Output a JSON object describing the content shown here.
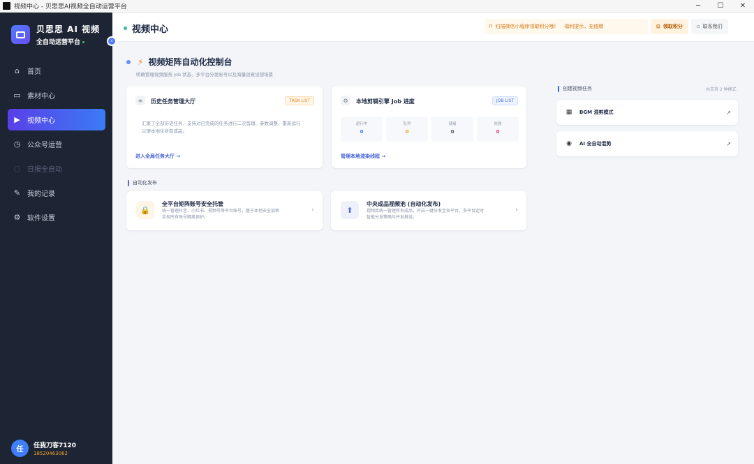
{
  "window": {
    "title": "视频中心 - 贝思思AI视频全自动运营平台",
    "controls": [
      "─",
      "☐",
      "✕"
    ]
  },
  "brand": {
    "title": "贝思思 AI 视频",
    "subtitle": "全自动运营平台"
  },
  "sidebar": {
    "collapse_icon": "‹",
    "items": [
      {
        "label": "首页",
        "icon": "⌂",
        "state": "normal"
      },
      {
        "label": "素材中心",
        "icon": "▭",
        "state": "normal"
      },
      {
        "label": "视频中心",
        "icon": "▶",
        "state": "active"
      },
      {
        "label": "公众号运营",
        "icon": "◷",
        "state": "normal"
      },
      {
        "label": "日报全自动",
        "icon": "◌",
        "state": "disabled"
      },
      {
        "label": "我的记录",
        "icon": "✎",
        "state": "normal"
      },
      {
        "label": "软件设置",
        "icon": "⚙",
        "state": "normal"
      }
    ]
  },
  "user": {
    "avatar": "任",
    "name": "任我刀客7120",
    "phone": "18520463062"
  },
  "header": {
    "page_title": "视频中心",
    "notice_a": "扫描微信小程序领取积分哦!",
    "notice_b": "福利提示，充值赠",
    "claim": "领取积分",
    "contact": "联系我们"
  },
  "section": {
    "title": "视频矩阵自动化控制台",
    "subtitle": "明确管理视频服务 Job 状态、多平台分发账号以及海量创意设想场景"
  },
  "history_card": {
    "title": "历史任务管理大厅",
    "tag": "TASK LIST",
    "desc_1": "汇聚了全部历史任务，支持对已完成的任务进行二次剪辑、参数调整、重新运行",
    "desc_2": "以便本地化所有成品。",
    "link": "进入全局任务大厅 →"
  },
  "job_card": {
    "title": "本地剪辑引擎 Job 进度",
    "tag": "JOB LIST",
    "stats": [
      {
        "label": "运行中",
        "value": "0",
        "color": "#3f7ef6"
      },
      {
        "label": "队列",
        "value": "0",
        "color": "#f0a020"
      },
      {
        "label": "就绪",
        "value": "0",
        "color": "#4b5568"
      },
      {
        "label": "失败",
        "value": "0",
        "color": "#e0457a"
      }
    ],
    "link": "管理本地渲染线程 →"
  },
  "auto_publish": {
    "heading": "自动化发布",
    "cards": [
      {
        "title": "全平台矩阵账号安全托管",
        "desc_1": "统一管理抖音、小红书、视频号等平台账号，基于本地安全加密",
        "desc_2": "实现所有账号隔离保护。",
        "icon": "🔒"
      },
      {
        "title": "中央成品视频池 (自动化发布)",
        "desc_1": "视频库统一管理所有成品，开启一键分发至各平台，多平台定时",
        "desc_2": "智能分发策略与并发推送。",
        "icon": "⬆"
      }
    ]
  },
  "create_task": {
    "heading": "创建视频任务",
    "hint": "共支持 2 种模式",
    "modes": [
      {
        "label": "BGM 混剪模式",
        "icon": "▦",
        "arrow": "↗"
      },
      {
        "label": "AI 全自动混剪",
        "icon": "◉",
        "arrow": "↗"
      }
    ]
  }
}
